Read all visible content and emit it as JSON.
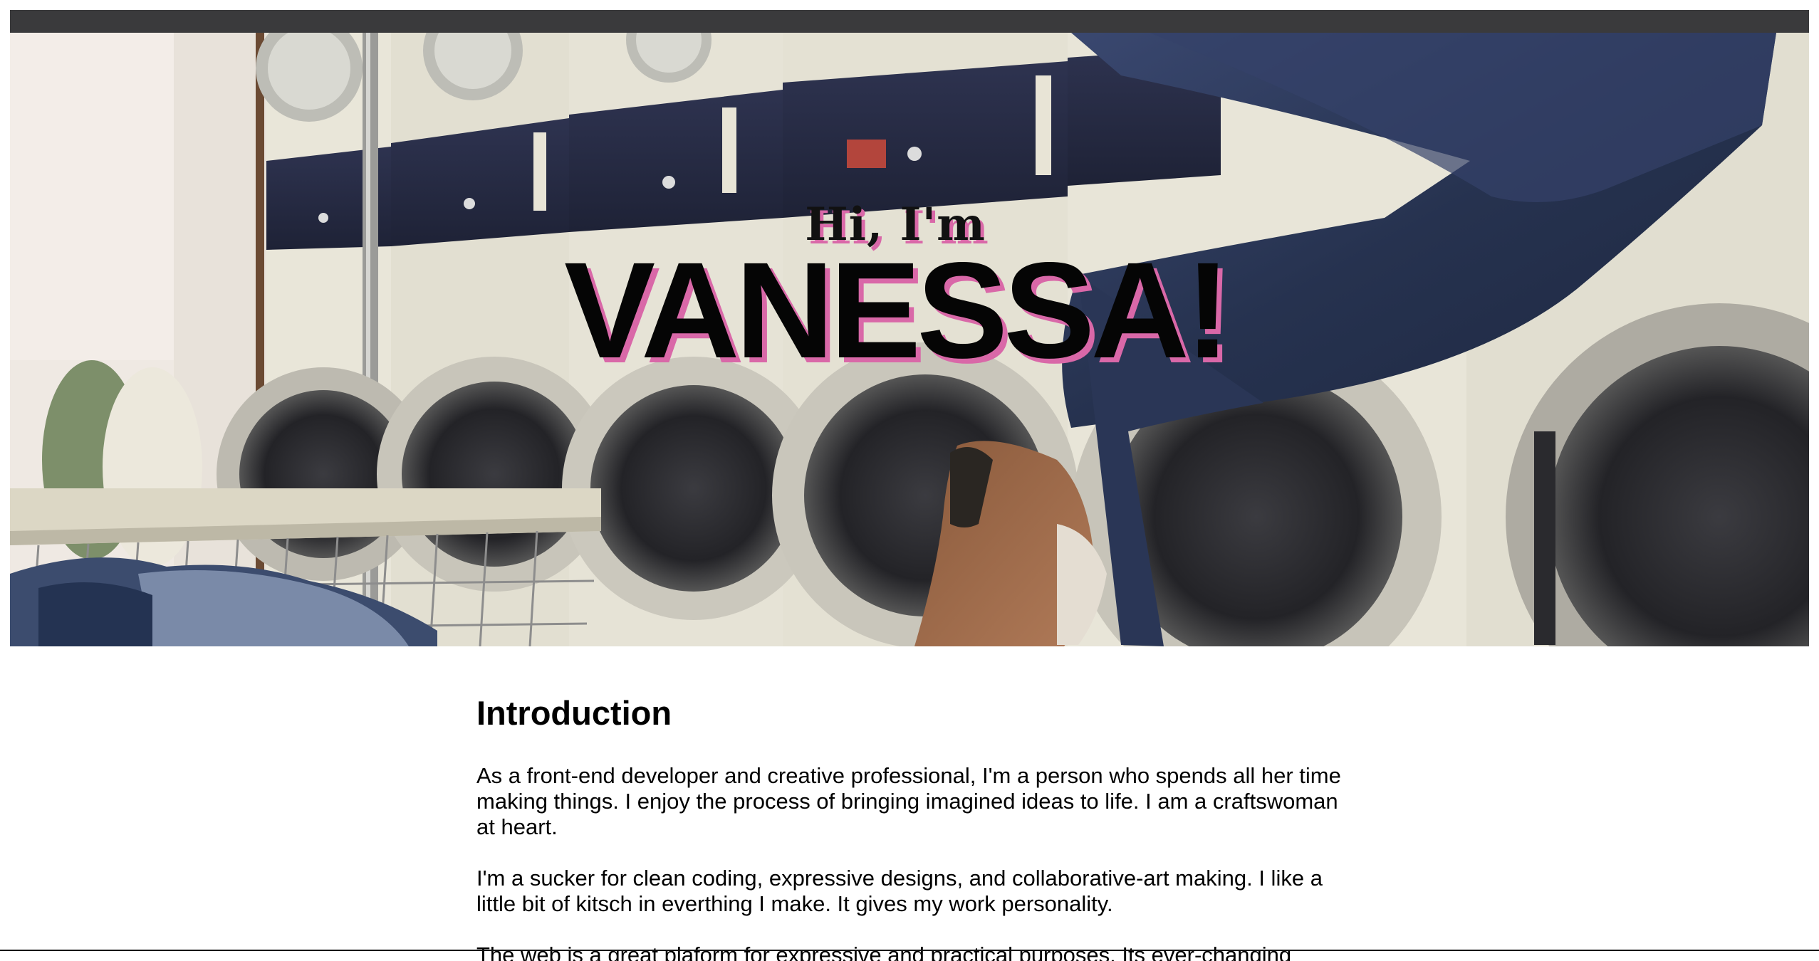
{
  "hero": {
    "greeting": "Hi, I'm",
    "name": "VANESSA!",
    "image_subject": "laundromat-photo",
    "shadow_color": "#d968a8"
  },
  "intro": {
    "heading": "Introduction",
    "paragraphs": [
      "As a front-end developer and creative professional, I'm a person who spends all her time making things. I enjoy the process of bringing imagined ideas to life. I am a craftswoman at heart.",
      "I'm a sucker for clean coding, expressive designs, and collaborative-art making. I like a little bit of kitsch in everthing I make. It gives my work personality.",
      "The web is a great plaform for expressive and practical purposes. Its ever-changing"
    ]
  },
  "colors": {
    "topbar": "#3a3a3c",
    "text": "#000000",
    "accent": "#d968a8"
  }
}
